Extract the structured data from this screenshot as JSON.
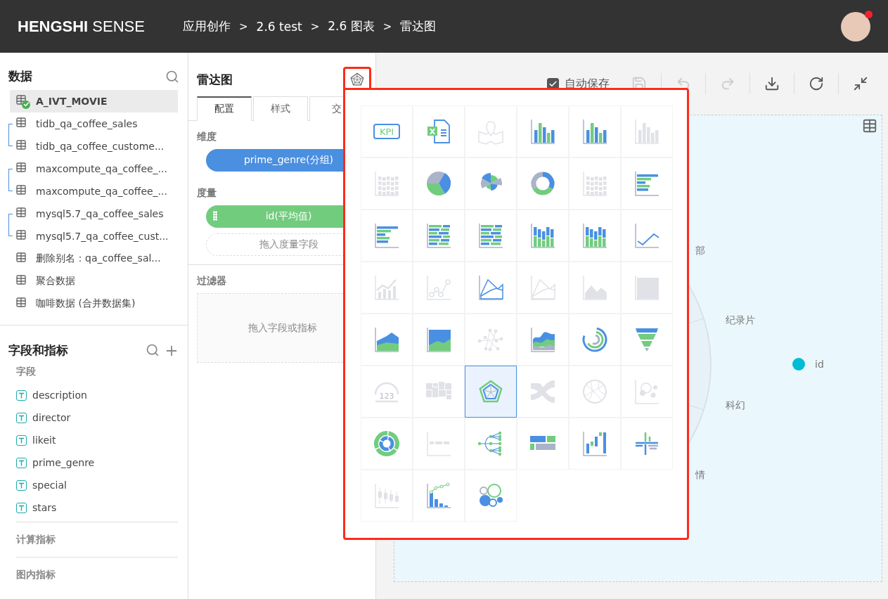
{
  "header": {
    "brand": "**HENGSHI** SENSE",
    "breadcrumb": [
      "应用创作",
      "2.6 test",
      "2.6 图表",
      "雷达图"
    ],
    "separator": ">",
    "avatar": {
      "notification": true
    }
  },
  "data_panel": {
    "title": "数据",
    "datasets": [
      {
        "kind": "item",
        "name": "A_IVT_MOVIE",
        "selected": true
      },
      {
        "kind": "linked",
        "items": [
          {
            "name": "tidb_qa_coffee_sales",
            "selected": false
          },
          {
            "name": "tidb_qa_coffee_custome...",
            "selected": false
          }
        ]
      },
      {
        "kind": "linked",
        "items": [
          {
            "name": "maxcompute_qa_coffee_...",
            "selected": false
          },
          {
            "name": "maxcompute_qa_coffee_...",
            "selected": false
          }
        ]
      },
      {
        "kind": "linked",
        "items": [
          {
            "name": "mysql5.7_qa_coffee_sales",
            "selected": false
          },
          {
            "name": "mysql5.7_qa_coffee_cust...",
            "selected": false
          }
        ]
      },
      {
        "kind": "item",
        "name": "删除别名：qa_coffee_sal...",
        "selected": false
      },
      {
        "kind": "item",
        "name": "聚合数据",
        "selected": false
      },
      {
        "kind": "item",
        "name": "咖啡数据 (合并数据集)",
        "selected": false
      }
    ]
  },
  "fields_panel": {
    "title": "字段和指标",
    "field_heading": "字段",
    "fields": [
      {
        "name": "description",
        "kind": "text"
      },
      {
        "name": "director",
        "kind": "text"
      },
      {
        "name": "likeit",
        "kind": "text"
      },
      {
        "name": "prime_genre",
        "kind": "text"
      },
      {
        "name": "special",
        "kind": "text"
      },
      {
        "name": "stars",
        "kind": "text"
      }
    ],
    "sections": [
      "计算指标",
      "图内指标"
    ]
  },
  "editor": {
    "title": "雷达图",
    "chart_button_highlighted": true,
    "tabs": [
      {
        "label": "配置",
        "selected": true
      },
      {
        "label": "样式",
        "selected": false
      },
      {
        "label": "交",
        "selected": false
      }
    ],
    "dimension": {
      "label": "维度",
      "pills": [
        "prime_genre(分组)"
      ]
    },
    "measure": {
      "label": "度量",
      "pills": [
        "id(平均值)"
      ],
      "drop_hint": "拖入度量字段"
    },
    "filter": {
      "label": "过滤器",
      "drop_hint": "拖入字段或指标"
    }
  },
  "toolbar": {
    "autosave": {
      "label": "自动保存",
      "checked": true
    },
    "buttons": [
      {
        "kind": "save",
        "disabled": true
      },
      {
        "kind": "undo",
        "disabled": true
      },
      {
        "kind": "redo",
        "disabled": true
      },
      {
        "kind": "download",
        "disabled": false
      },
      {
        "kind": "refresh",
        "disabled": false
      },
      {
        "kind": "collapse",
        "disabled": false
      }
    ]
  },
  "chart": {
    "axis_labels": [
      "部",
      "纪录片",
      "科幻",
      "情"
    ],
    "legend": [
      {
        "label": "id",
        "color": "#00bcd4"
      }
    ]
  },
  "chart_picker": {
    "items": [
      {
        "kind": "kpi",
        "text": "KPI",
        "enabled": true,
        "selected": false
      },
      {
        "kind": "excel",
        "text": "X",
        "enabled": true,
        "selected": false
      },
      {
        "kind": "map",
        "enabled": false,
        "selected": false
      },
      {
        "kind": "column",
        "enabled": true,
        "selected": false
      },
      {
        "kind": "column",
        "enabled": true,
        "selected": false
      },
      {
        "kind": "column",
        "enabled": false,
        "selected": false
      },
      {
        "kind": "heat",
        "enabled": false,
        "selected": false
      },
      {
        "kind": "pie",
        "enabled": true,
        "selected": false
      },
      {
        "kind": "rose",
        "enabled": true,
        "selected": false
      },
      {
        "kind": "donut",
        "enabled": true,
        "selected": false
      },
      {
        "kind": "heat",
        "enabled": false,
        "selected": false
      },
      {
        "kind": "hbar",
        "enabled": true,
        "selected": false
      },
      {
        "kind": "hbar",
        "enabled": true,
        "selected": false
      },
      {
        "kind": "stackedh",
        "enabled": true,
        "selected": false
      },
      {
        "kind": "stackedh",
        "enabled": true,
        "selected": false
      },
      {
        "kind": "stackedv",
        "enabled": true,
        "selected": false
      },
      {
        "kind": "stackedv",
        "enabled": true,
        "selected": false
      },
      {
        "kind": "line",
        "enabled": true,
        "selected": false
      },
      {
        "kind": "combo",
        "enabled": false,
        "selected": false
      },
      {
        "kind": "scatterline",
        "enabled": false,
        "selected": false
      },
      {
        "kind": "arealine",
        "enabled": true,
        "selected": false
      },
      {
        "kind": "arealine",
        "enabled": false,
        "selected": false
      },
      {
        "kind": "area",
        "enabled": false,
        "selected": false
      },
      {
        "kind": "areafull",
        "enabled": false,
        "selected": false
      },
      {
        "kind": "areastack",
        "enabled": true,
        "selected": false
      },
      {
        "kind": "areafull",
        "enabled": true,
        "selected": false
      },
      {
        "kind": "network",
        "enabled": false,
        "selected": false
      },
      {
        "kind": "stream",
        "enabled": true,
        "selected": false
      },
      {
        "kind": "radial",
        "enabled": true,
        "selected": false
      },
      {
        "kind": "funnel",
        "enabled": true,
        "selected": false
      },
      {
        "kind": "gauge",
        "text": "123",
        "enabled": false,
        "selected": false
      },
      {
        "kind": "treemap",
        "enabled": false,
        "selected": false
      },
      {
        "kind": "radar",
        "enabled": true,
        "selected": true
      },
      {
        "kind": "sankey",
        "enabled": false,
        "selected": false
      },
      {
        "kind": "chord",
        "enabled": false,
        "selected": false
      },
      {
        "kind": "bubble",
        "enabled": false,
        "selected": false
      },
      {
        "kind": "sunburst",
        "enabled": true,
        "selected": false
      },
      {
        "kind": "dotline",
        "enabled": false,
        "selected": false
      },
      {
        "kind": "tree",
        "enabled": true,
        "selected": false
      },
      {
        "kind": "matrix",
        "enabled": true,
        "selected": false
      },
      {
        "kind": "waterfall",
        "enabled": true,
        "selected": false
      },
      {
        "kind": "cross",
        "enabled": true,
        "selected": false
      },
      {
        "kind": "boxplot",
        "enabled": false,
        "selected": false
      },
      {
        "kind": "pareto",
        "enabled": true,
        "selected": false
      },
      {
        "kind": "packing",
        "enabled": true,
        "selected": false
      }
    ]
  }
}
